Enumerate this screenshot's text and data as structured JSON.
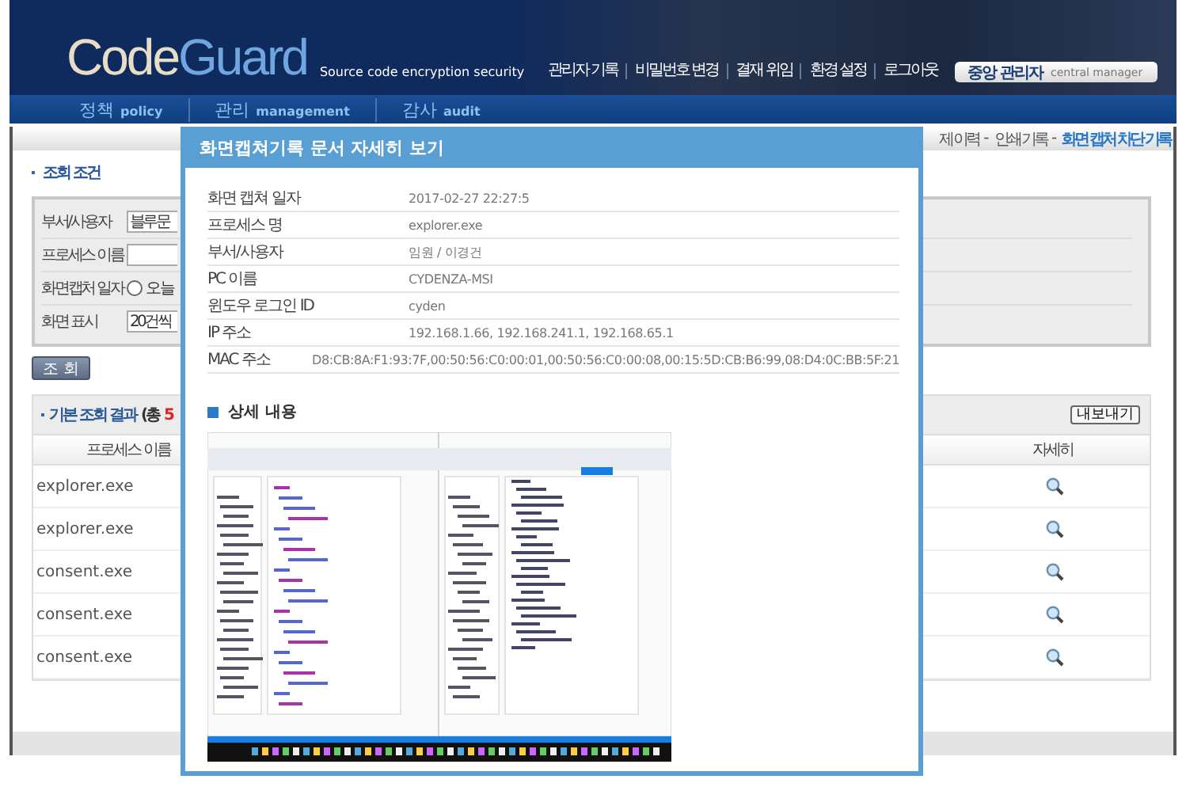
{
  "header": {
    "logo": {
      "part_1": "Code",
      "part_2": "Guard"
    },
    "tagline": "Source code encryption security",
    "top_links": [
      "관리자 기록",
      "비밀번호 변경",
      "결재 위임",
      "환경 설정",
      "로그아웃"
    ],
    "user_badge": {
      "role": "중앙 관리자",
      "role_en": "central manager"
    }
  },
  "nav": [
    {
      "label": "정책",
      "label_en": "policy"
    },
    {
      "label": "관리",
      "label_en": "management"
    },
    {
      "label": "감사",
      "label_en": "audit"
    }
  ],
  "breadcrumb": {
    "separator": "-",
    "items": [
      {
        "label": "제 이력",
        "selected": false
      },
      {
        "label": "인쇄 기록",
        "selected": false
      },
      {
        "label": "화면 캡처 차단 기록",
        "selected": true
      }
    ]
  },
  "search": {
    "title": "조회 조건",
    "fields": [
      {
        "kind": "text",
        "label": "부서/사용자",
        "value": "블루문"
      },
      {
        "kind": "text",
        "label": "프로세스 이름"
      },
      {
        "kind": "radio",
        "label": "화면캡처 일자",
        "options": [
          {
            "label": "오늘",
            "selected": false
          }
        ]
      },
      {
        "kind": "select",
        "label": "화면 표시",
        "value": "20건씩"
      }
    ],
    "button": "조 회"
  },
  "results": {
    "title": "기본 조회 결과",
    "count_prefix": "(총",
    "count": "5",
    "export_button": "내보내기",
    "columns": [
      "프로세스 이름",
      "자세히"
    ],
    "rows": [
      {
        "process": "explorer.exe"
      },
      {
        "process": "explorer.exe"
      },
      {
        "process": "consent.exe"
      },
      {
        "process": "consent.exe"
      },
      {
        "process": "consent.exe"
      }
    ]
  },
  "modal": {
    "title": "화면캡쳐기록 문서 자세히 보기",
    "details": [
      {
        "label": "화면 캡쳐 일자",
        "value": "2017-02-27 22:27:5"
      },
      {
        "label": "프로세스 명",
        "value": "explorer.exe"
      },
      {
        "label": "부서/사용자",
        "value": "임원 / 이경건"
      },
      {
        "label": "PC 이름",
        "value": "CYDENZA-MSI"
      },
      {
        "label": "윈도우 로그인 ID",
        "value": "cyden"
      },
      {
        "label": "IP 주소",
        "value": "192.168.1.66, 192.168.241.1, 192.168.65.1"
      },
      {
        "label": "MAC 주소",
        "value": "D8:CB:8A:F1:93:7F,00:50:56:C0:00:01,00:50:56:C0:00:08,00:15:5D:CB:B6:99,08:D4:0C:BB:5F:21"
      }
    ],
    "section_title": "상세 내용"
  }
}
